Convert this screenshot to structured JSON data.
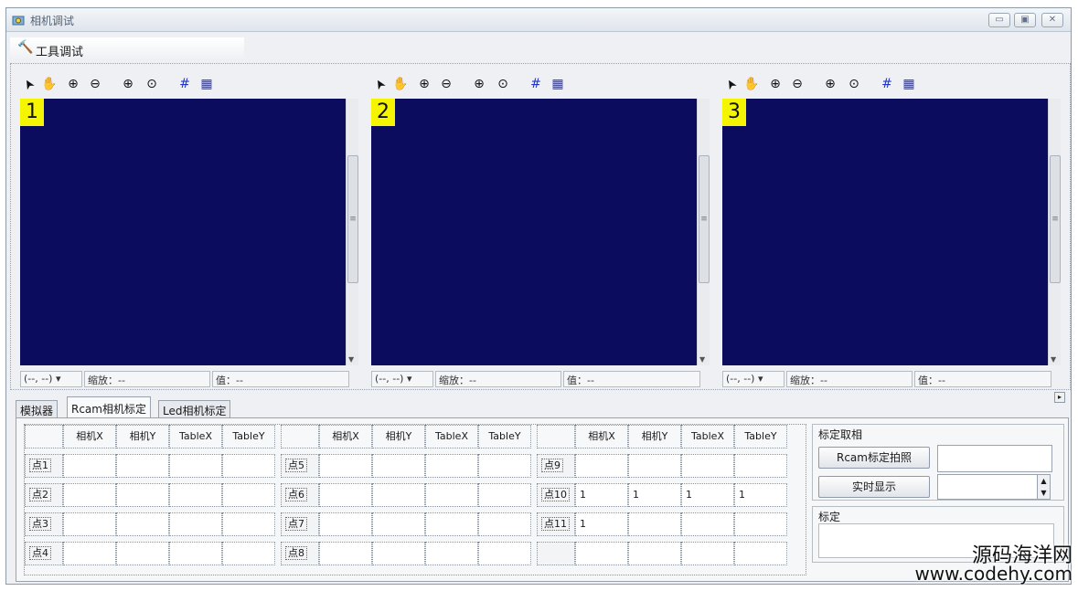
{
  "window": {
    "title": "相机调试",
    "buttons": [
      "▭",
      "▣",
      "✕"
    ]
  },
  "menu": {
    "item_label": "工具调试"
  },
  "viewers": [
    {
      "number": "1",
      "status": {
        "coord": "(--, --)",
        "zoom": "缩放：--",
        "value": "值：--"
      }
    },
    {
      "number": "2",
      "status": {
        "coord": "(--, --)",
        "zoom": "缩放：--",
        "value": "值：--"
      }
    },
    {
      "number": "3",
      "status": {
        "coord": "(--, --)",
        "zoom": "缩放：--",
        "value": "值：--"
      }
    }
  ],
  "tabs": [
    {
      "label": "模拟器",
      "active": false
    },
    {
      "label": "Rcam相机标定",
      "active": true
    },
    {
      "label": "Led相机标定",
      "active": false
    }
  ],
  "table": {
    "headers": [
      "相机X",
      "相机Y",
      "TableX",
      "TableY"
    ],
    "blocks": [
      {
        "rows": [
          {
            "label": "点1",
            "values": [
              "",
              "",
              "",
              ""
            ]
          },
          {
            "label": "点2",
            "values": [
              "",
              "",
              "",
              ""
            ]
          },
          {
            "label": "点3",
            "values": [
              "",
              "",
              "",
              ""
            ]
          },
          {
            "label": "点4",
            "values": [
              "",
              "",
              "",
              ""
            ]
          }
        ]
      },
      {
        "rows": [
          {
            "label": "点5",
            "values": [
              "",
              "",
              "",
              ""
            ]
          },
          {
            "label": "点6",
            "values": [
              "",
              "",
              "",
              ""
            ]
          },
          {
            "label": "点7",
            "values": [
              "",
              "",
              "",
              ""
            ]
          },
          {
            "label": "点8",
            "values": [
              "",
              "",
              "",
              ""
            ]
          }
        ]
      },
      {
        "rows": [
          {
            "label": "点9",
            "values": [
              "",
              "",
              "",
              ""
            ]
          },
          {
            "label": "点10",
            "values": [
              "1",
              "1",
              "1",
              "1"
            ]
          },
          {
            "label": "点11",
            "values": [
              "1",
              "",
              "",
              ""
            ]
          },
          {
            "label": "",
            "values": [
              "",
              "",
              "",
              ""
            ]
          }
        ]
      }
    ]
  },
  "capture_group": {
    "title": "标定取相",
    "capture_button": "Rcam标定拍照",
    "live_button": "实时显示"
  },
  "calib_group": {
    "title": "标定"
  },
  "watermark": {
    "line1": "源码海洋网",
    "line2": "www.codehy.com"
  }
}
